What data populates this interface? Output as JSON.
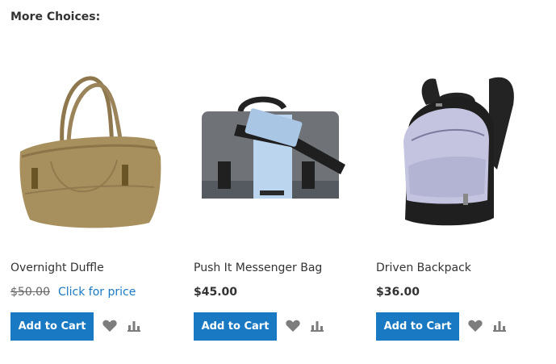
{
  "section": {
    "title": "More Choices:"
  },
  "products": [
    {
      "name": "Overnight Duffle",
      "old_price": "$50.00",
      "price_link": "Click for price",
      "add_to_cart": "Add to Cart",
      "colors": {
        "body": "#a8905e"
      }
    },
    {
      "name": "Push It Messenger Bag",
      "price": "$45.00",
      "add_to_cart": "Add to Cart",
      "colors": {
        "body": "#6f7378",
        "stripe": "#bcd5ee"
      }
    },
    {
      "name": "Driven Backpack",
      "price": "$36.00",
      "add_to_cart": "Add to Cart",
      "colors": {
        "body": "#c4c4e0",
        "trim": "#232323"
      }
    }
  ],
  "icons": {
    "wishlist": "heart-icon",
    "compare": "compare-bars-icon"
  },
  "colors": {
    "accent": "#1979c3",
    "icon_gray": "#7d7d7d",
    "text": "#333333"
  }
}
